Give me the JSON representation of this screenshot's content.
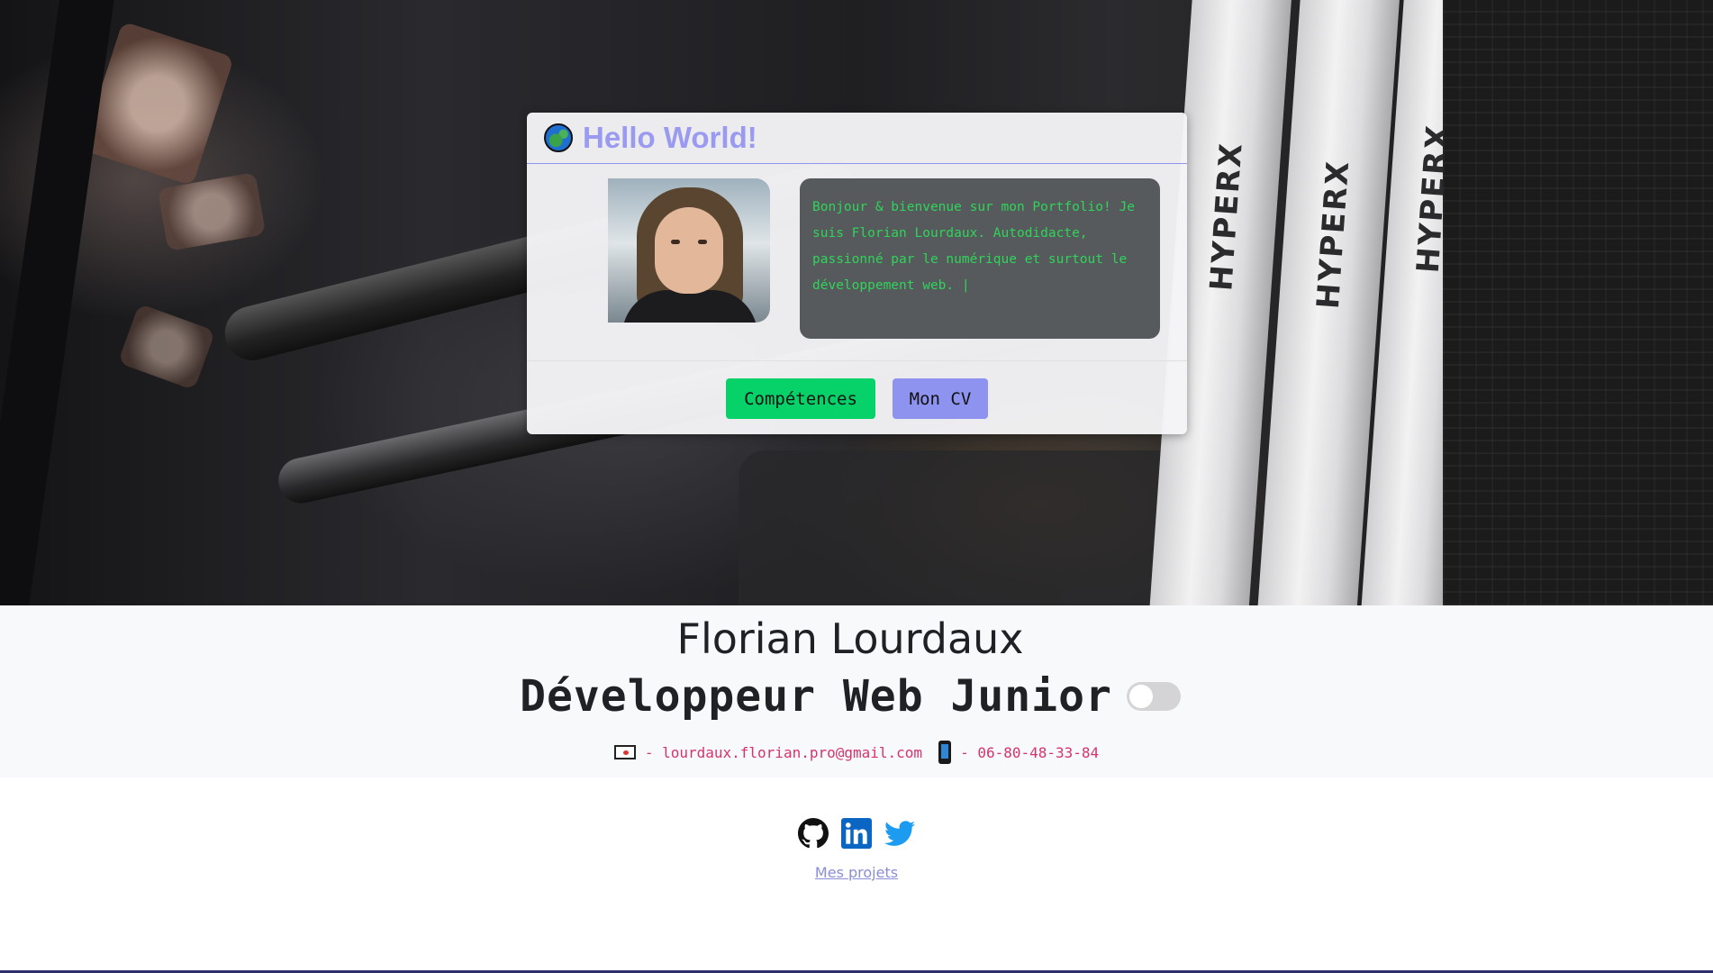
{
  "card": {
    "title": "Hello World!",
    "icon": "globe-icon",
    "bio": "Bonjour & bienvenue sur mon Portfolio! Je suis Florian Lourdaux. Autodidacte, passionné par le numérique et surtout le développement web. |",
    "buttons": {
      "skills": "Compétences",
      "cv": "Mon CV"
    }
  },
  "profile": {
    "name": "Florian Lourdaux",
    "role": "Développeur Web Junior",
    "email_text": "- lourdaux.florian.pro@gmail.com",
    "phone_text": "- 06-80-48-33-84"
  },
  "theme_toggle": {
    "state": "off"
  },
  "socials": [
    "github-icon",
    "linkedin-icon",
    "twitter-icon"
  ],
  "links": {
    "projects": "Mes projets"
  },
  "colors": {
    "accent": "#9a9bf0",
    "terminal_text": "#2fd45a",
    "skills_button": "#06d269",
    "cv_button": "#8e93f0",
    "contact_text": "#d6336c"
  }
}
